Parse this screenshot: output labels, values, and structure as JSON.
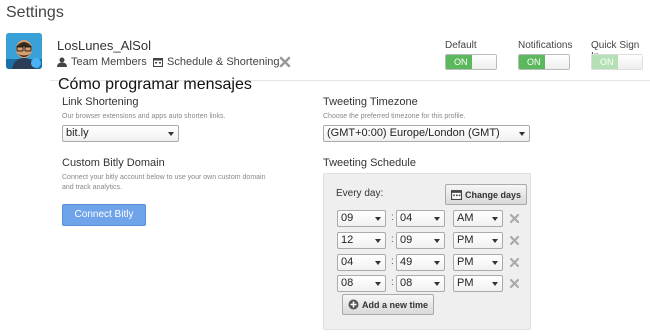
{
  "page": {
    "title": "Settings"
  },
  "profile": {
    "name": "LosLunes_AlSol"
  },
  "tabs": [
    {
      "label": "Team Members",
      "icon": "user-icon"
    },
    {
      "label": "Schedule & Shortening",
      "icon": "calendar-icon"
    }
  ],
  "toggles": [
    {
      "label": "Default",
      "state": "ON",
      "enabled": true
    },
    {
      "label": "Notifications",
      "state": "ON",
      "enabled": true
    },
    {
      "label": "Quick Sign In",
      "state": "ON",
      "enabled": false
    }
  ],
  "overlay_heading": "Cómo programar mensajes",
  "link_shortening": {
    "title": "Link Shortening",
    "desc": "Our browser extensions and apps auto shorten links.",
    "value": "bit.ly"
  },
  "custom_domain": {
    "title": "Custom Bitly Domain",
    "desc_line1": "Connect your bitly account below to use your own custom domain",
    "desc_line2": "and track analytics.",
    "button": "Connect Bitly"
  },
  "timezone": {
    "title": "Tweeting Timezone",
    "desc": "Choose the preferred timezone for this profile.",
    "value": "(GMT+0:00) Europe/London (GMT)"
  },
  "schedule": {
    "title": "Tweeting Schedule",
    "every_day": "Every day:",
    "change_days": "Change days",
    "add_time": "Add a new time",
    "times": [
      {
        "hour": "09",
        "minute": "04",
        "ampm": "AM"
      },
      {
        "hour": "12",
        "minute": "09",
        "ampm": "PM"
      },
      {
        "hour": "04",
        "minute": "49",
        "ampm": "PM"
      },
      {
        "hour": "08",
        "minute": "08",
        "ampm": "PM"
      }
    ]
  },
  "colors": {
    "toggle_on": "#5cb85c",
    "button_blue": "#6fa3ea"
  }
}
